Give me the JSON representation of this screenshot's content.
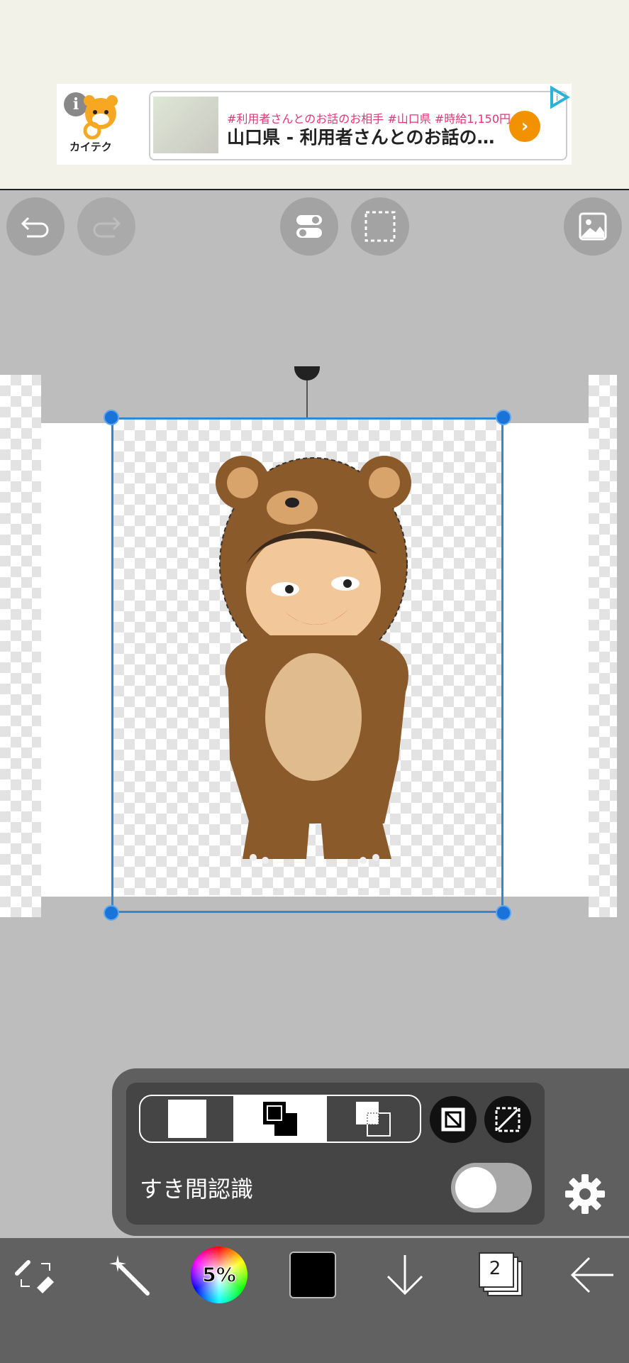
{
  "ad": {
    "info_label": "i",
    "logo_text": "カイテク",
    "small_text": "#利用者さんとのお話のお相手 #山口県 #時給1,150円",
    "headline": "山口県 - 利用者さんとのお話のお...",
    "arrow": "›"
  },
  "toolbar_top": {
    "buttons": [
      "undo-icon",
      "redo-icon",
      "toggle-icon",
      "select-icon",
      "image-icon"
    ]
  },
  "panel": {
    "gap_label": "すき間認識",
    "gap_toggle_on": false
  },
  "bottom": {
    "brush_percent": "5%",
    "layers_count": "2",
    "current_color": "#000000"
  },
  "colors": {
    "accent": "#2c88d9",
    "ad_arrow": "#f39200",
    "ad_pink": "#e8327a"
  }
}
